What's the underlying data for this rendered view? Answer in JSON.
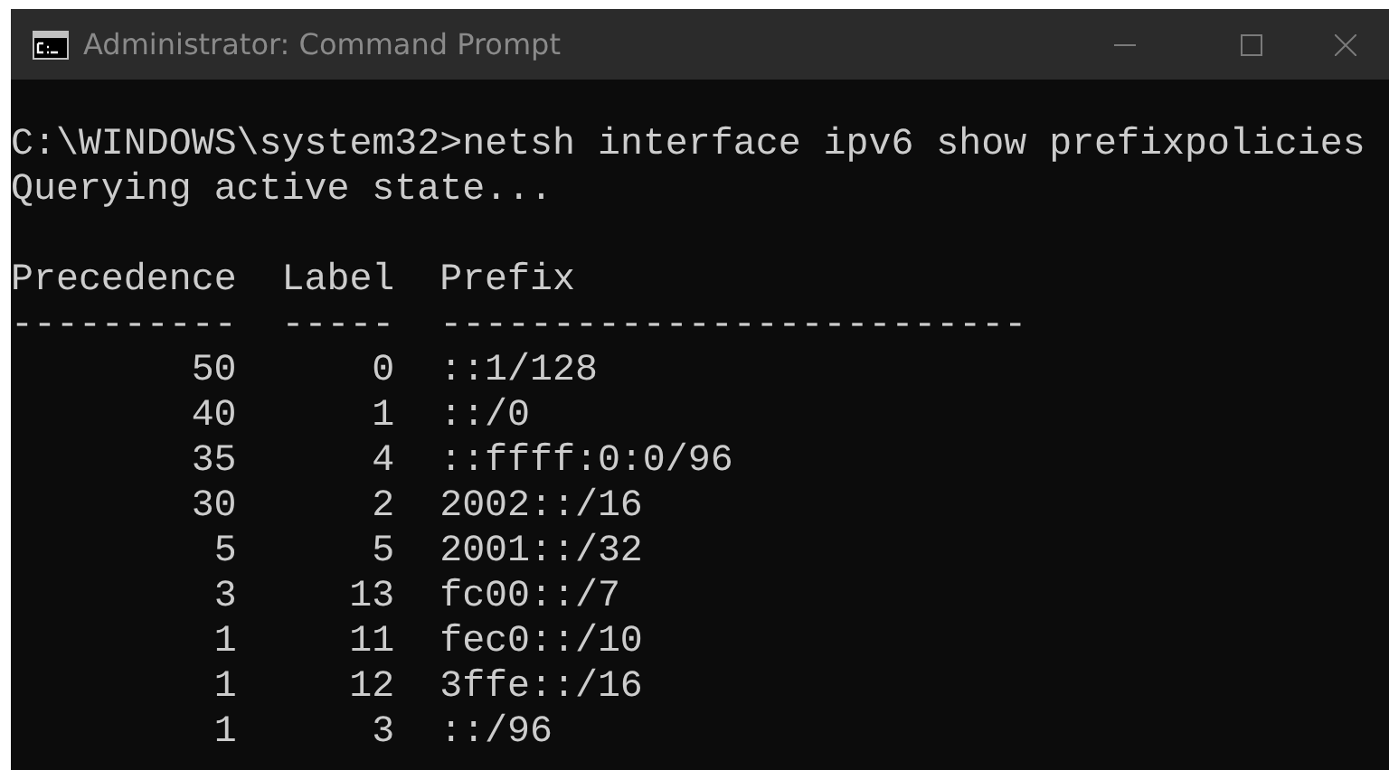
{
  "window": {
    "title": "Administrator: Command Prompt"
  },
  "console": {
    "lines_before": [
      "C:\\WINDOWS\\system32>netsh interface ipv6 show prefixpolicies",
      "Querying active state..."
    ],
    "table": {
      "columns": [
        {
          "header": "Precedence",
          "rule": "----------"
        },
        {
          "header": "Label",
          "rule": "-----"
        },
        {
          "header": "Prefix",
          "rule": "--------------------------"
        }
      ],
      "rows": [
        [
          "50",
          "0",
          "::1/128"
        ],
        [
          "40",
          "1",
          "::/0"
        ],
        [
          "35",
          "4",
          "::ffff:0:0/96"
        ],
        [
          "30",
          "2",
          "2002::/16"
        ],
        [
          "5",
          "5",
          "2001::/32"
        ],
        [
          "3",
          "13",
          "fc00::/7"
        ],
        [
          "1",
          "11",
          "fec0::/10"
        ],
        [
          "1",
          "12",
          "3ffe::/16"
        ],
        [
          "1",
          "3",
          "::/96"
        ]
      ]
    }
  }
}
